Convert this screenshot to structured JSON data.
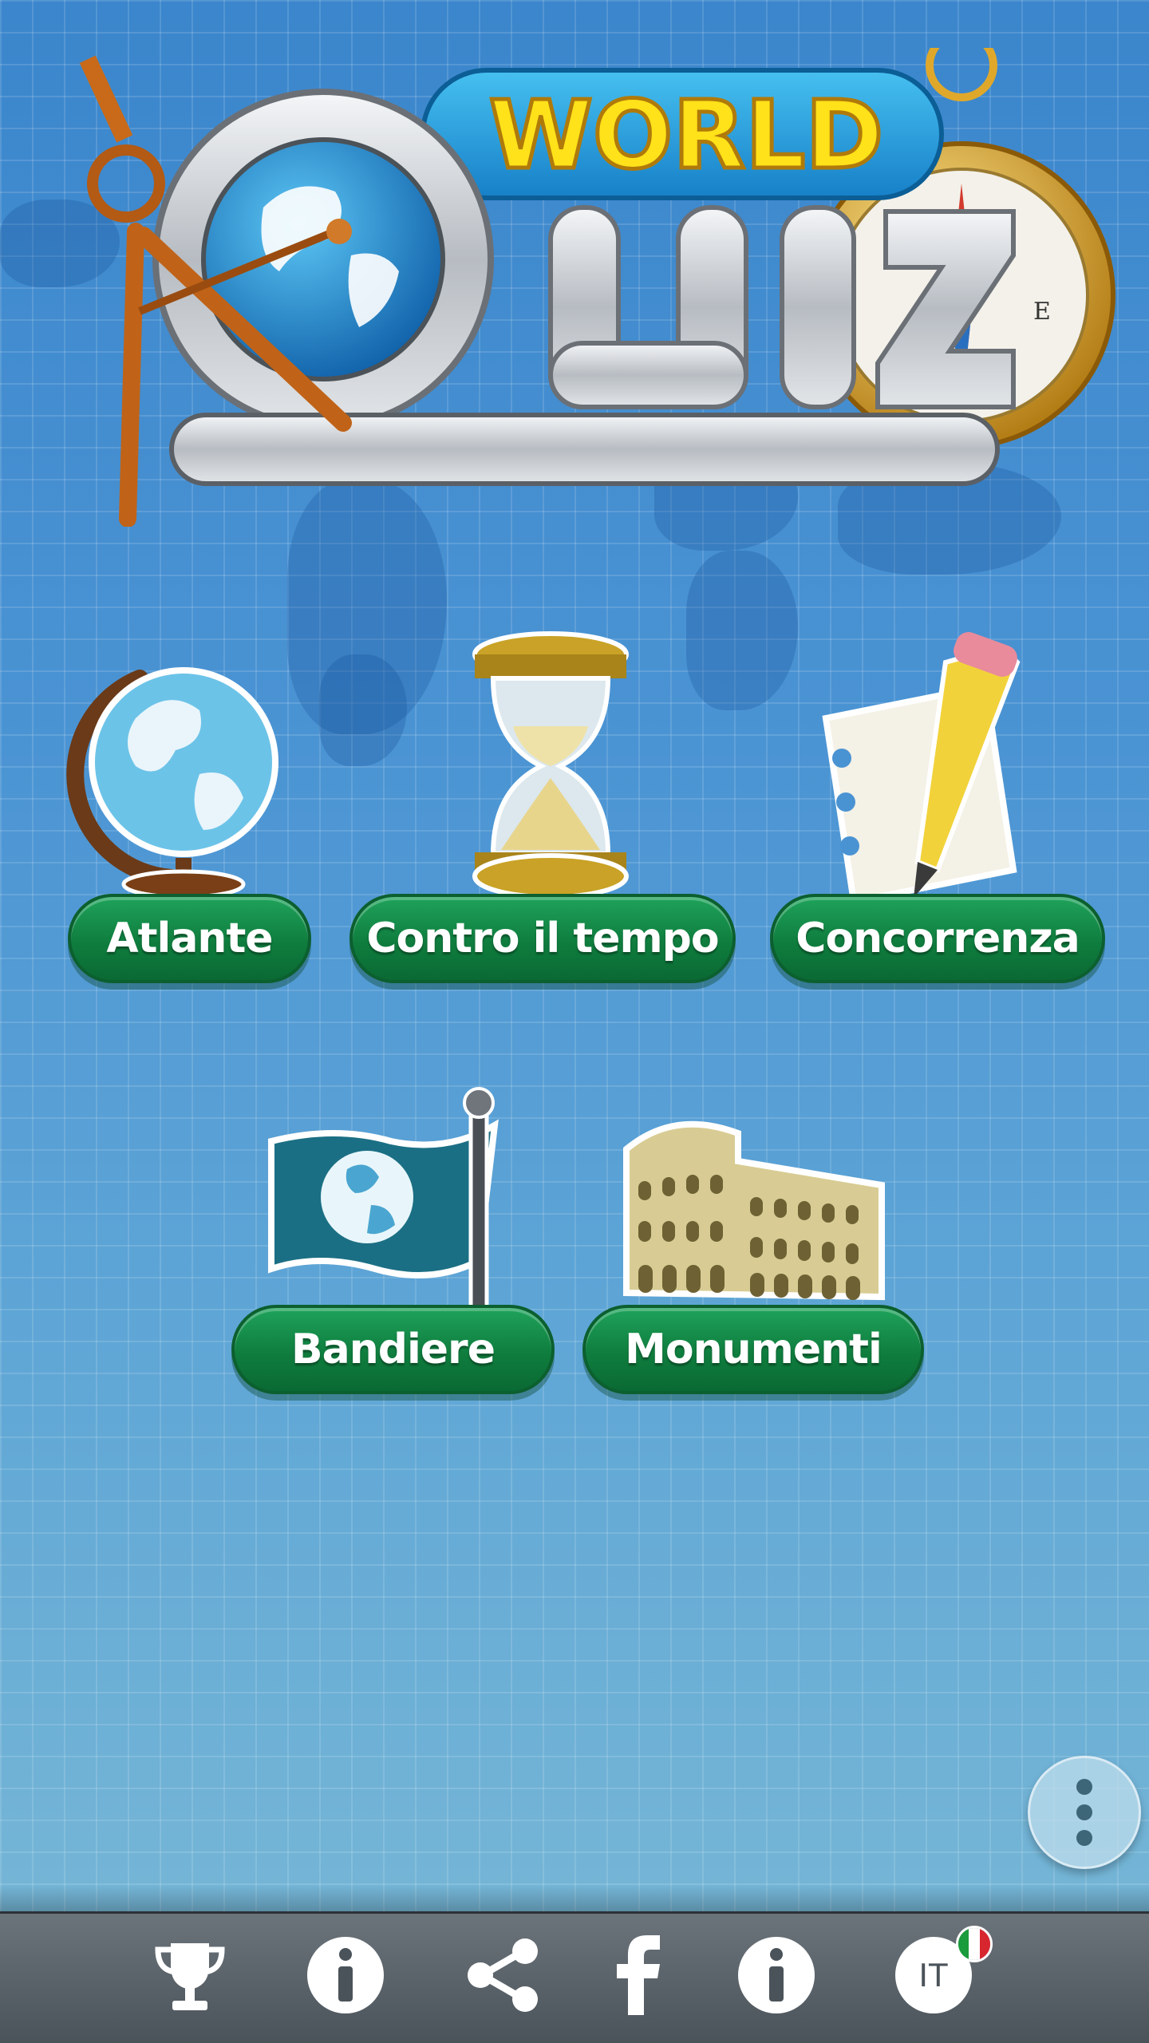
{
  "app": {
    "logo_word_world": "WORLD",
    "logo_word_quiz": "QUIZ"
  },
  "modes_row1": [
    {
      "label": "Atlante",
      "icon": "globe-icon"
    },
    {
      "label": "Contro il tempo",
      "icon": "hourglass-icon"
    },
    {
      "label": "Concorrenza",
      "icon": "pencil-paper-icon"
    }
  ],
  "modes_row2": [
    {
      "label": "Bandiere",
      "icon": "flag-icon"
    },
    {
      "label": "Monumenti",
      "icon": "colosseum-icon"
    }
  ],
  "menu": {
    "icon": "more-vertical-icon"
  },
  "bottom_bar": {
    "items": [
      {
        "icon": "trophy-icon"
      },
      {
        "icon": "info-icon"
      },
      {
        "icon": "share-icon"
      },
      {
        "icon": "facebook-icon"
      },
      {
        "icon": "info-icon"
      },
      {
        "icon": "language-icon",
        "label": "IT"
      }
    ]
  },
  "colors": {
    "background": "#4a93d3",
    "button_green": "#0f7d3e",
    "bar_gray": "#5a6269",
    "logo_yellow": "#ffe21a"
  }
}
